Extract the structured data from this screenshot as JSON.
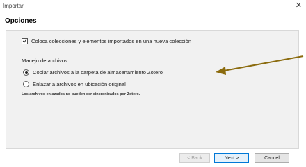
{
  "window": {
    "title": "Importar"
  },
  "header": {
    "title": "Opciones"
  },
  "options": {
    "collection_checkbox_label": "Coloca colecciones y elementos importados en una nueva colección",
    "file_handling_heading": "Manejo de archivos",
    "copy_files_label": "Copiar archivos a la carpeta de almacenamiento Zotero",
    "link_files_label": "Enlazar a archivos en ubicación original",
    "note": "Los archivos enlazados no pueden ser sincronizados por Zotero."
  },
  "footer": {
    "back_label": "< Back",
    "next_label": "Next >",
    "cancel_label": "Cancel"
  },
  "annotation": {
    "arrow_color": "#8B6B0E"
  }
}
